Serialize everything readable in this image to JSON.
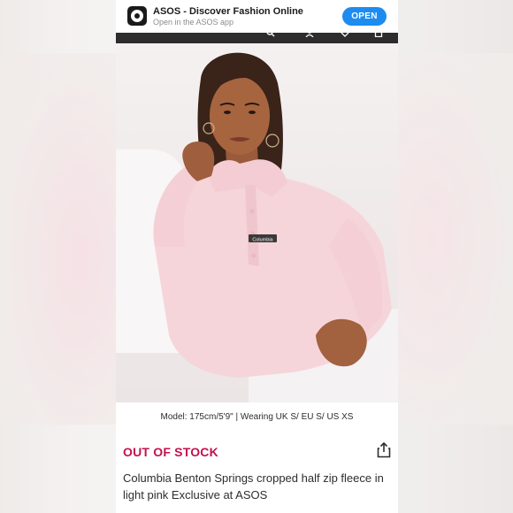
{
  "app_banner": {
    "title": "ASOS - Discover Fashion Online",
    "subtitle": "Open in the ASOS app",
    "open_label": "OPEN",
    "accent": "#1d8cf0"
  },
  "header_icons": [
    "search-icon",
    "account-icon",
    "wishlist-icon",
    "bag-icon"
  ],
  "gallery": {
    "brand_tag": "Columbia",
    "dots": 4,
    "active_index": 0
  },
  "product": {
    "model_info": "Model: 175cm/5'9\" | Wearing UK S/ EU S/ US XS",
    "stock_status": "OUT OF STOCK",
    "stock_color": "#c4114e",
    "title": "Columbia Benton Springs cropped half zip fleece in light pink Exclusive at ASOS"
  }
}
